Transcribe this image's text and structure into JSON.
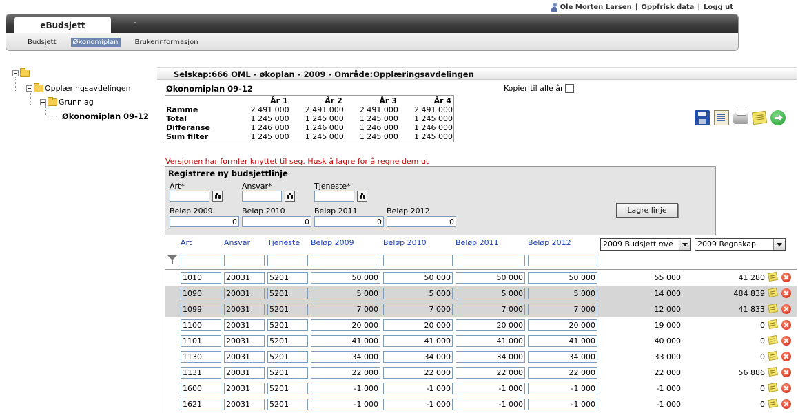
{
  "userbar": {
    "user": "Ole Morten Larsen",
    "refresh": "Oppfrisk data",
    "logout": "Logg ut",
    "sep": "|"
  },
  "header": {
    "brand": "eBudsjett",
    "nav": [
      {
        "label": "Budsjett",
        "active": false
      },
      {
        "label": "Økonomiplan",
        "active": true
      },
      {
        "label": "Brukerinformasjon",
        "active": false
      }
    ]
  },
  "tree": {
    "level1": "Opplæringsavdelingen",
    "level2": "Grunnlag",
    "level3": "Økonomiplan 09-12"
  },
  "main": {
    "title": "Selskap:666 OML - økoplan - 2009 - Område:Opplæringsavdelingen",
    "subtitle": "Økonomiplan 09-12",
    "copy_all_label": "Kopier til alle år",
    "summary": {
      "headers": [
        "År 1",
        "År 2",
        "År 3",
        "År 4"
      ],
      "rows": [
        {
          "label": "Ramme",
          "values": [
            "2 491 000",
            "2 491 000",
            "2 491 000",
            "2 491 000"
          ]
        },
        {
          "label": "Total",
          "values": [
            "1 245 000",
            "1 245 000",
            "1 245 000",
            "1 245 000"
          ]
        },
        {
          "label": "Differanse",
          "values": [
            "1 246 000",
            "1 246 000",
            "1 246 000",
            "1 246 000"
          ]
        },
        {
          "label": "Sum filter",
          "values": [
            "1 245 000",
            "1 245 000",
            "1 245 000",
            "1 245 000"
          ]
        }
      ]
    },
    "toolbar_icons": [
      "save-icon",
      "document-icon",
      "print-icon",
      "notes-icon",
      "go-arrow-icon"
    ],
    "warning": "Versjonen har formler knyttet til seg. Husk å lagre for å regne dem ut",
    "register": {
      "title": "Registrere ny budsjettlinje",
      "art_label": "Art*",
      "ansvar_label": "Ansvar*",
      "tjeneste_label": "Tjeneste*",
      "belop_labels": [
        "Beløp 2009",
        "Beløp 2010",
        "Beløp 2011",
        "Beløp 2012"
      ],
      "belop_values": [
        "0",
        "0",
        "0",
        "0"
      ],
      "save_button": "Lagre linje"
    },
    "columns": [
      "Art",
      "Ansvar",
      "Tjeneste",
      "Beløp 2009",
      "Beløp 2010",
      "Beløp 2011",
      "Beløp 2012"
    ],
    "compare_select_1": "2009 Budsjett m/e",
    "compare_select_2": "2009 Regnskap",
    "rows": [
      {
        "art": "1010",
        "ansvar": "20031",
        "tjeneste": "5201",
        "b2009": "50 000",
        "b2010": "50 000",
        "b2011": "50 000",
        "b2012": "50 000",
        "budsjett": "55 000",
        "regnskap": "41 280",
        "shade": false
      },
      {
        "art": "1090",
        "ansvar": "20031",
        "tjeneste": "5201",
        "b2009": "5 000",
        "b2010": "5 000",
        "b2011": "5 000",
        "b2012": "5 000",
        "budsjett": "14 000",
        "regnskap": "484 839",
        "shade": true
      },
      {
        "art": "1099",
        "ansvar": "20031",
        "tjeneste": "5201",
        "b2009": "7 000",
        "b2010": "7 000",
        "b2011": "7 000",
        "b2012": "7 000",
        "budsjett": "12 000",
        "regnskap": "41 833",
        "shade": true
      },
      {
        "art": "1100",
        "ansvar": "20031",
        "tjeneste": "5201",
        "b2009": "20 000",
        "b2010": "20 000",
        "b2011": "20 000",
        "b2012": "20 000",
        "budsjett": "19 000",
        "regnskap": "0",
        "shade": false
      },
      {
        "art": "1101",
        "ansvar": "20031",
        "tjeneste": "5201",
        "b2009": "41 000",
        "b2010": "41 000",
        "b2011": "41 000",
        "b2012": "41 000",
        "budsjett": "40 000",
        "regnskap": "0",
        "shade": false
      },
      {
        "art": "1130",
        "ansvar": "20031",
        "tjeneste": "5201",
        "b2009": "34 000",
        "b2010": "34 000",
        "b2011": "34 000",
        "b2012": "34 000",
        "budsjett": "33 000",
        "regnskap": "0",
        "shade": false
      },
      {
        "art": "1131",
        "ansvar": "20031",
        "tjeneste": "5201",
        "b2009": "22 000",
        "b2010": "22 000",
        "b2011": "22 000",
        "b2012": "22 000",
        "budsjett": "22 000",
        "regnskap": "56 886",
        "shade": false
      },
      {
        "art": "1600",
        "ansvar": "20031",
        "tjeneste": "5201",
        "b2009": "-1 000",
        "b2010": "-1 000",
        "b2011": "-1 000",
        "b2012": "-1 000",
        "budsjett": "-1 000",
        "regnskap": "0",
        "shade": false
      },
      {
        "art": "1621",
        "ansvar": "20031",
        "tjeneste": "5201",
        "b2009": "-1 000",
        "b2010": "-1 000",
        "b2011": "-1 000",
        "b2012": "-1 000",
        "budsjett": "-1 000",
        "regnskap": "0",
        "shade": false
      }
    ]
  }
}
